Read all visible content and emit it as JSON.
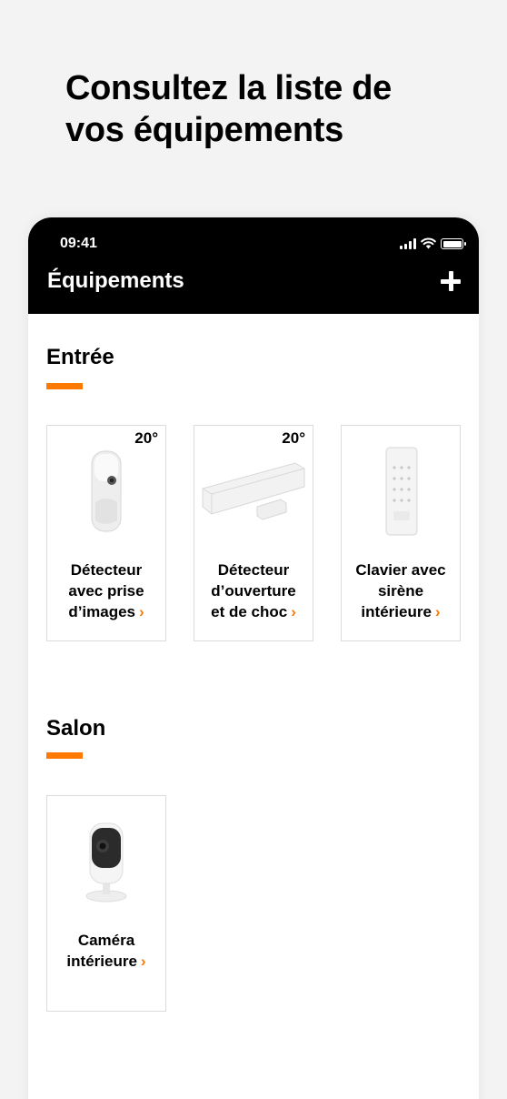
{
  "headline": {
    "line1": "Consultez la liste de",
    "line2": "vos équipements"
  },
  "status_bar": {
    "time": "09:41"
  },
  "header": {
    "title": "Équipements"
  },
  "colors": {
    "accent": "#ff7900",
    "header_bg": "#000000",
    "background": "#f3f3f3"
  },
  "icons": {
    "add": "plus-icon",
    "chevron": "chevron-right-icon",
    "chevron_glyph": "›"
  },
  "sections": [
    {
      "title": "Entrée",
      "items": [
        {
          "temperature": "20°",
          "label_lines": [
            "Détecteur",
            "avec prise",
            "d’images"
          ]
        },
        {
          "temperature": "20°",
          "label_lines": [
            "Détecteur",
            "d’ouverture",
            "et de choc"
          ]
        },
        {
          "temperature": "",
          "label_lines": [
            "Clavier avec",
            "sirène",
            "intérieure"
          ]
        }
      ]
    },
    {
      "title": "Salon",
      "items": [
        {
          "temperature": "",
          "label_lines": [
            "Caméra",
            "intérieure"
          ]
        }
      ]
    }
  ]
}
